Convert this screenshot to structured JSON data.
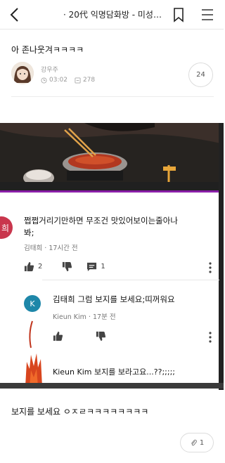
{
  "header": {
    "title": "· 20代 익명담화방 - 미성년...",
    "back_icon": "chevron-left-icon",
    "bookmark_icon": "bookmark-icon",
    "menu_icon": "hamburger-menu-icon"
  },
  "post": {
    "title": "아 존나웃겨ㅋㅋㅋㅋ",
    "author": "강우주",
    "time": "03:02",
    "views": "278",
    "comment_count": "24",
    "body": "보지를 보세요 ㅇㅈㄹㅋㅋㅋㅋㅋㅋㅋㅋ",
    "attachment_count": "1"
  },
  "embedded": {
    "comment": {
      "avatar_text": "희",
      "text": "쩝쩝거리기만하면 무조건 맛있어보이는줄아나봐;",
      "author": "김태희",
      "time": "17시간 전",
      "likes": "2",
      "replies": "1"
    },
    "reply": {
      "avatar_text": "K",
      "text": "김태희 그럼 보지를 보세요;띠꺼워요",
      "author": "Kieun Kim",
      "time": "17분 전"
    },
    "reply2": {
      "text": "Kieun Kim 보지를 보라고요...??;;;;;"
    }
  },
  "colors": {
    "comment_avatar": "#c9364d",
    "reply_avatar": "#1e87a9",
    "video_progress": "#8a1fa8"
  }
}
